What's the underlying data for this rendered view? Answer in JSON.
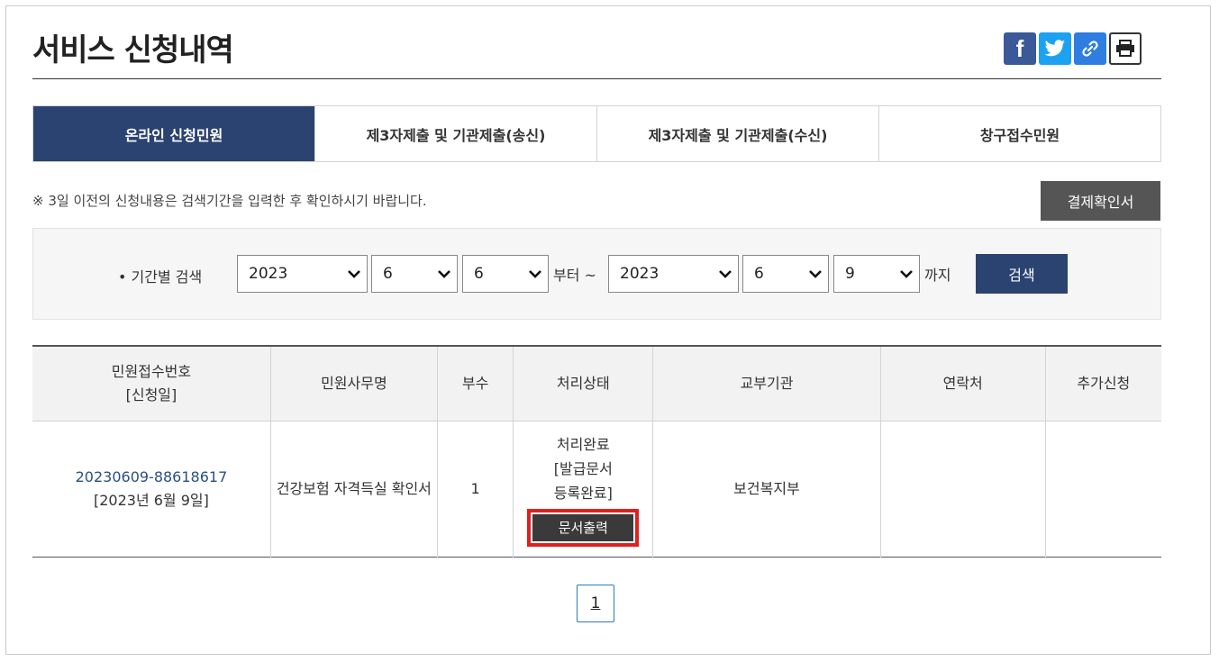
{
  "page": {
    "title": "서비스 신청내역"
  },
  "share": {
    "facebook": "f"
  },
  "tabs": [
    {
      "label": "온라인 신청민원",
      "active": true
    },
    {
      "label": "제3자제출 및 기관제출(송신)"
    },
    {
      "label": "제3자제출 및 기관제출(수신)"
    },
    {
      "label": "창구접수민원"
    }
  ],
  "notice": "※ 3일 이전의 신청내용은 검색기간을 입력한 후 확인하시기 바랍니다.",
  "receipt_button": "결제확인서",
  "search": {
    "label": "• 기간별 검색",
    "from": {
      "year": "2023",
      "month": "6",
      "day": "6"
    },
    "from_suffix": "부터 ~",
    "to": {
      "year": "2023",
      "month": "6",
      "day": "9"
    },
    "to_suffix": "까지",
    "button": "검색"
  },
  "table": {
    "headers": {
      "receipt_no_line1": "민원접수번호",
      "receipt_no_line2": "[신청일]",
      "name": "민원사무명",
      "copies": "부수",
      "status": "처리상태",
      "agency": "교부기관",
      "contact": "연락처",
      "extra": "추가신청"
    },
    "rows": [
      {
        "receipt_no": "20230609-88618617",
        "date": "[2023년 6월 9일]",
        "name": "건강보험 자격득실 확인서",
        "copies": "1",
        "status_line1": "처리완료",
        "status_line2": "[발급문서",
        "status_line3": "등록완료]",
        "print_button": "문서출력",
        "agency": "보건복지부",
        "contact": "",
        "extra": ""
      }
    ]
  },
  "pagination": {
    "current": "1"
  },
  "colors": {
    "primary": "#2b4371",
    "highlight": "#e02020",
    "link": "#2b4f86"
  }
}
